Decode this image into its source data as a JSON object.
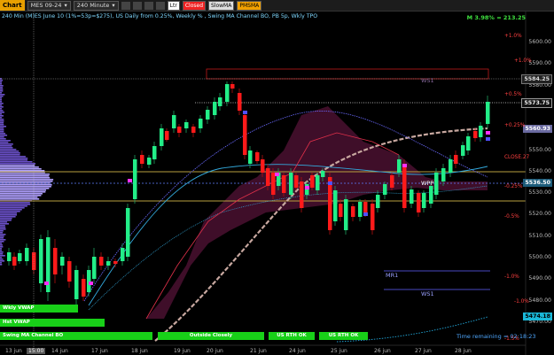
{
  "toolbar": {
    "chart_btn": "Chart",
    "symbol": "MES 09-24",
    "interval": "240 Minute",
    "btn_ltr": "Ltr",
    "btn_closed": "Closed",
    "btn_slowma": "SlowMA",
    "btn_pmsma": "PMSMA"
  },
  "title": "240 Min (M)ES June 10 (1%=53p=$275), US Daily from 0.25%, Weekly % , Swing MA Channel BO, PB 5p, Wkly TPO",
  "stat": "M 3.98% = 213.25",
  "price_tags": {
    "p1": "5584.25",
    "p2": "5573.75",
    "p3": "5560.93",
    "p4": "5536.50",
    "p5": "5474.18"
  },
  "axis_prices": [
    "5600.00",
    "5590.00",
    "5580.00",
    "5570.00",
    "5560.00",
    "5550.00",
    "5540.00",
    "5530.00",
    "5520.00",
    "5510.00",
    "5500.00",
    "5490.00",
    "5480.00",
    "5470.00"
  ],
  "pct_labels": {
    "a": "+1.0%",
    "b": "+1.0%",
    "c": "+0.5%",
    "d": "+0.25%",
    "e": "+0.25%",
    "f": "-0.25%",
    "g": "-0.5%",
    "h": "-1.0%",
    "i": "-1.0%",
    "j": "-1.5%",
    "close": "CLOSE.27"
  },
  "levels": {
    "ws1_top": "WS1",
    "wpp": "WPP",
    "mr1": "MR1",
    "ws1": "WS1"
  },
  "bars": {
    "wkly_vwap": "Wkly VWAP",
    "hst_vwap": "Hst VWAP",
    "swing": "Swing MA Channel BO",
    "outside": "Outside Closely",
    "us_rth1": "US RTH OK",
    "us_rth2": "US RTH OK"
  },
  "dates": [
    "13 jun",
    "15:00",
    "14 jun",
    "17 jun",
    "18 jun",
    "19 jun",
    "20 jun",
    "21 jun",
    "24 jun",
    "25 jun",
    "26 jun",
    "27 jun",
    "28 jun"
  ],
  "time_remaining": "Time remaining = 02:18:23",
  "colors": {
    "up": "#22ee88",
    "down": "#ff1a1a",
    "accent": "#e8a000"
  }
}
